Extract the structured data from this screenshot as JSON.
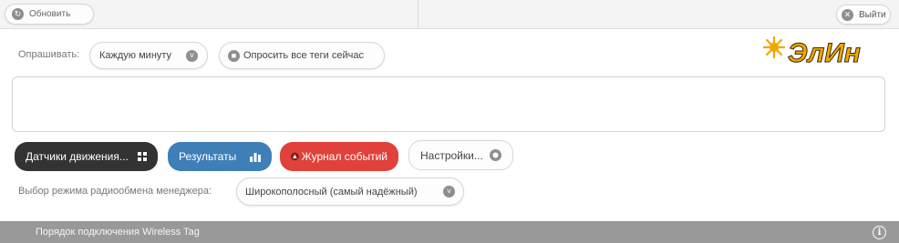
{
  "topbar": {
    "refresh_label": "Обновить",
    "logout_label": "Выйти"
  },
  "polling": {
    "label": "Опрашивать:",
    "interval_value": "Каждую минуту",
    "poll_now_label": "Опросить все теги сейчас"
  },
  "logo_text": "ЭлИн",
  "message_area": {
    "value": ""
  },
  "actions": {
    "motion_sensors_label": "Датчики движения...",
    "results_label": "Результаты",
    "event_log_label": "Журнал событий",
    "settings_label": "Настройки..."
  },
  "radio_mode": {
    "label": "Выбор режима радиообмена менеджера:",
    "value": "Широкополосный (самый надёжный)"
  },
  "footer": {
    "link_label": "Порядок подключения Wireless Tag"
  },
  "colors": {
    "motion_button": "#333333",
    "results_button": "#3f7fb8",
    "event_log_button": "#e0413a",
    "footer_bar": "#999999",
    "logo_orange": "#f0a800"
  },
  "icons": {
    "refresh": "refresh-icon",
    "logout": "close-circle-icon",
    "dropdown": "chevron-down-circle-icon",
    "poll_now": "stop-circle-icon",
    "motion": "grid-icon",
    "results": "bar-chart-icon",
    "event_log": "warning-icon",
    "settings": "circle-icon",
    "info": "info-icon"
  }
}
